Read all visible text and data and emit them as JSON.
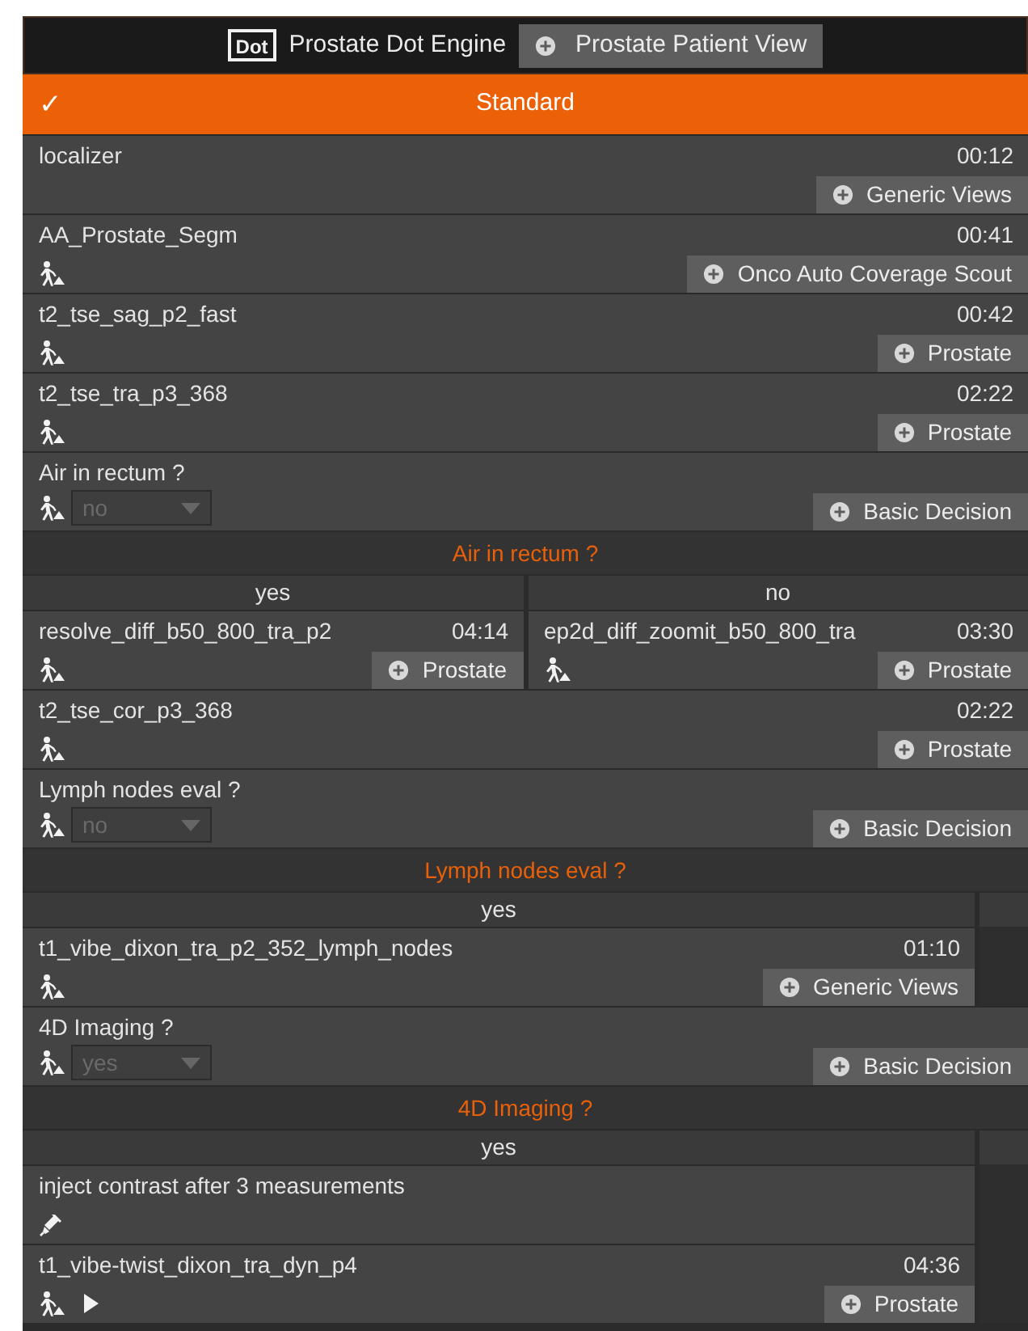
{
  "header": {
    "logo": "Dot",
    "title": "Prostate Dot Engine",
    "view_button": "Prostate Patient View"
  },
  "strategy": {
    "check": "✓",
    "name": "Standard",
    "selected": true
  },
  "items": [
    {
      "kind": "scout",
      "name": "localizer",
      "time": "00:12",
      "button": "Generic Views"
    },
    {
      "kind": "sequence",
      "name": "AA_Prostate_Segm",
      "time": "00:41",
      "button": "Onco Auto Coverage Scout"
    },
    {
      "kind": "sequence",
      "name": "t2_tse_sag_p2_fast",
      "time": "00:42",
      "button": "Prostate"
    },
    {
      "kind": "sequence",
      "name": "t2_tse_tra_p3_368",
      "time": "02:22",
      "button": "Prostate"
    },
    {
      "kind": "decision",
      "name": "Air in rectum ?",
      "value": "no",
      "disabled": true,
      "button": "Basic Decision"
    },
    {
      "kind": "branch",
      "title": "Air in rectum ?",
      "branches": [
        {
          "label": "yes",
          "steps": [
            {
              "kind": "sequence",
              "name": "resolve_diff_b50_800_tra_p2",
              "time": "04:14",
              "button": "Prostate"
            }
          ]
        },
        {
          "label": "no",
          "steps": [
            {
              "kind": "sequence",
              "name": "ep2d_diff_zoomit_b50_800_tra",
              "time": "03:30",
              "button": "Prostate"
            }
          ]
        }
      ]
    },
    {
      "kind": "sequence",
      "name": "t2_tse_cor_p3_368",
      "time": "02:22",
      "button": "Prostate"
    },
    {
      "kind": "decision",
      "name": "Lymph nodes eval ?",
      "value": "no",
      "disabled": true,
      "button": "Basic Decision"
    },
    {
      "kind": "branch",
      "title": "Lymph nodes eval ?",
      "branches": [
        {
          "label": "yes",
          "steps": [
            {
              "kind": "sequence",
              "name": "t1_vibe_dixon_tra_p2_352_lymph_nodes",
              "time": "01:10",
              "button": "Generic Views"
            }
          ]
        },
        {
          "kind": "empty"
        }
      ]
    },
    {
      "kind": "decision",
      "name": "4D Imaging ?",
      "value": "yes",
      "disabled": true,
      "button": "Basic Decision"
    },
    {
      "kind": "branch",
      "title": "4D Imaging ?",
      "branches": [
        {
          "label": "yes",
          "steps": [
            {
              "kind": "injection",
              "name": "inject contrast after 3 measurements"
            },
            {
              "kind": "sequence",
              "name": "t1_vibe-twist_dixon_tra_dyn_p4",
              "time": "04:36",
              "button": "Prostate",
              "play": true
            }
          ]
        },
        {
          "kind": "empty"
        }
      ]
    }
  ]
}
